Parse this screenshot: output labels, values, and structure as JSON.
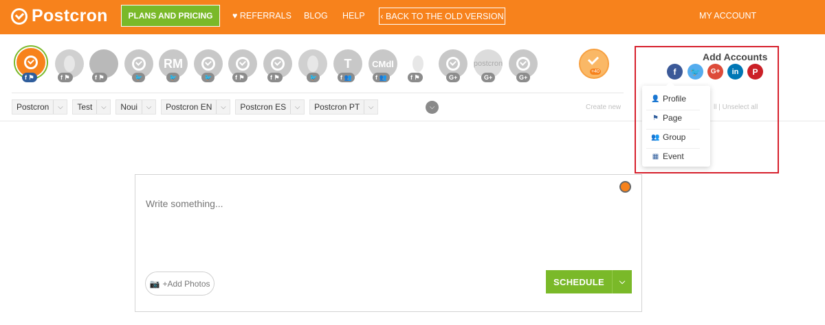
{
  "header": {
    "logo_text": "Postcron",
    "plans_label": "PLANS AND PRICING",
    "referrals_label": "REFERRALS",
    "blog_label": "BLOG",
    "help_label": "HELP",
    "back_label": "BACK TO THE OLD VERSION",
    "account_label": "MY ACCOUNT"
  },
  "accounts": [
    {
      "initials": "",
      "badge": "f ⚑",
      "active": true
    },
    {
      "initials": "",
      "badge": "f ⚑"
    },
    {
      "initials": "",
      "badge": "f ⚑"
    },
    {
      "initials": "",
      "badge": "🐦"
    },
    {
      "initials": "RM",
      "badge": "🐦"
    },
    {
      "initials": "",
      "badge": "🐦"
    },
    {
      "initials": "",
      "badge": "f ⚑"
    },
    {
      "initials": "",
      "badge": "f ⚑"
    },
    {
      "initials": "",
      "badge": "🐦"
    },
    {
      "initials": "T",
      "badge": "f 👥"
    },
    {
      "initials": "CMdl",
      "badge": "f 👥"
    },
    {
      "initials": "",
      "badge": "f ⚑"
    },
    {
      "initials": "",
      "badge": "G+"
    },
    {
      "initials": "postcron",
      "badge": "G+"
    },
    {
      "initials": "",
      "badge": "G+"
    }
  ],
  "plus_count": "+40",
  "group_tabs": [
    "Postcron",
    "Test",
    "Noui",
    "Postcron EN",
    "Postcron ES",
    "Postcron PT"
  ],
  "add_accounts": {
    "title": "Add Accounts",
    "networks": [
      "f",
      "t",
      "G+",
      "in",
      "P"
    ],
    "menu": [
      {
        "label": "Profile",
        "icon": "person-icon"
      },
      {
        "label": "Page",
        "icon": "flag-icon"
      },
      {
        "label": "Group",
        "icon": "group-icon"
      },
      {
        "label": "Event",
        "icon": "calendar-icon"
      }
    ]
  },
  "faded": {
    "left": "Create new",
    "right": "ll | Unselect all"
  },
  "composer": {
    "placeholder": "Write something...",
    "add_photos_label": "+Add Photos",
    "schedule_label": "SCHEDULE"
  }
}
